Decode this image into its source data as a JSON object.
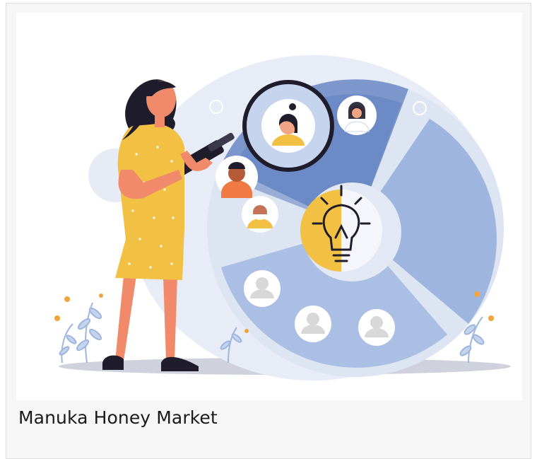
{
  "card": {
    "caption": "Manuka Honey Market"
  },
  "illustration": {
    "subject": "woman-with-magnifying-glass-and-pie-chart",
    "colors": {
      "pie_light": "#dfe5f2",
      "pie_mid": "#9fb6dc",
      "pie_dark": "#6f8fc8",
      "dress": "#f2c043",
      "skin": "#f08a6a",
      "hair": "#1f1c2c",
      "bulb_yellow": "#f2c043",
      "leaf": "#9fb6dc",
      "shadow": "#c8cbd6"
    }
  }
}
